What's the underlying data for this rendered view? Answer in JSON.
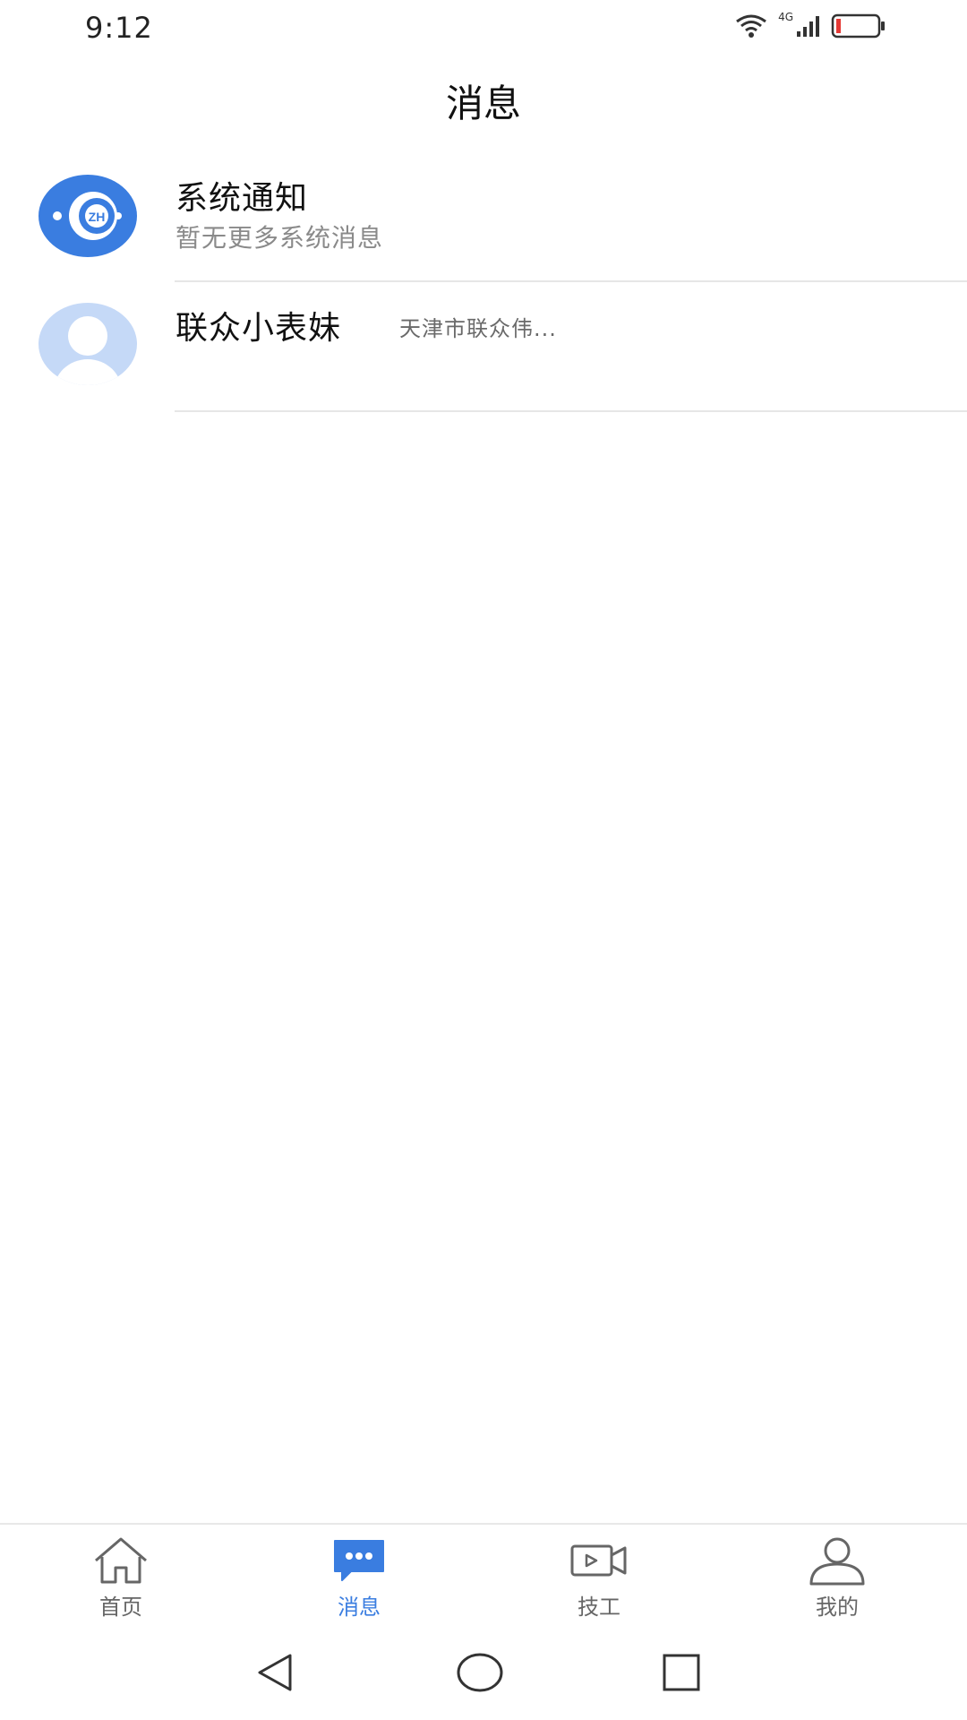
{
  "status_bar": {
    "time": "9:12",
    "network": "4G",
    "battery_color": "#e53935"
  },
  "header": {
    "title": "消息"
  },
  "messages": [
    {
      "name": "系统通知",
      "subtitle": "暂无更多系统消息",
      "avatar_icon": "system-notification-icon",
      "avatar_color": "#3a7de0"
    },
    {
      "name": "联众小表妹",
      "preview": "天津市联众伟...",
      "avatar_icon": "default-user-icon",
      "avatar_color": "#c5d9f7"
    }
  ],
  "tab_bar": {
    "active": "消息",
    "accent": "#3a7de0",
    "tabs": [
      {
        "label": "首页",
        "icon": "home-icon"
      },
      {
        "label": "消息",
        "icon": "chat-bubble-icon"
      },
      {
        "label": "技工",
        "icon": "video-camera-icon"
      },
      {
        "label": "我的",
        "icon": "person-icon"
      }
    ]
  },
  "nav_bar": {
    "buttons": [
      "back-icon",
      "home-circle-icon",
      "recents-icon"
    ]
  }
}
